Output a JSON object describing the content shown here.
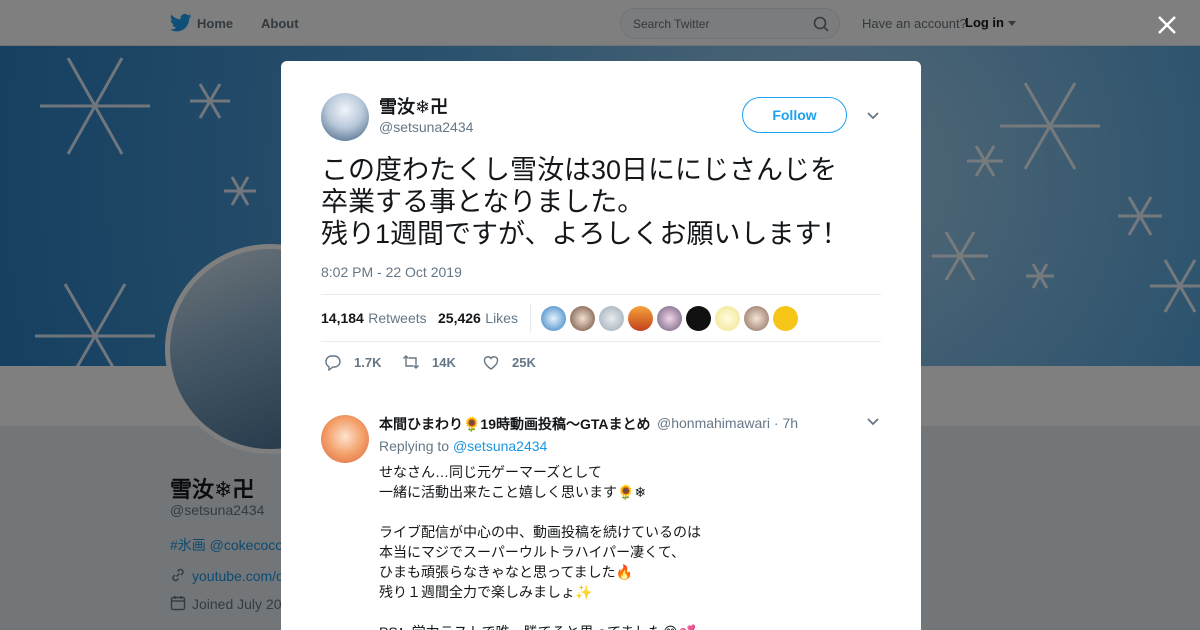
{
  "nav": {
    "home_label": "Home",
    "about_label": "About",
    "search_placeholder": "Search Twitter",
    "account_prompt": "Have an account?",
    "login_label": "Log in"
  },
  "profile": {
    "name": "雪汝❄卍",
    "handle": "@setsuna2434",
    "tags": "#氷画 @cokecoco",
    "link": "youtube.com/c",
    "joined": "Joined July 20"
  },
  "tweet": {
    "name": "雪汝❄卍",
    "handle": "@setsuna2434",
    "follow_label": "Follow",
    "text": "この度わたくし雪汝は30日ににじさんじを\n卒業する事となりました。\n残り1週間ですが、よろしくお願いします！",
    "timestamp": "8:02 PM - 22 Oct 2019",
    "retweets_count": "14,184",
    "retweets_label": "Retweets",
    "likes_count": "25,426",
    "likes_label": "Likes",
    "reply_count": "1.7K",
    "retweet_count_short": "14K",
    "like_count_short": "25K"
  },
  "reply": {
    "name": "本間ひまわり🌻19時動画投稿～GTAまとめ",
    "handle_time": "@honmahimawari · 7h",
    "replying_prefix": "Replying to",
    "replying_to": "@setsuna2434",
    "text": "せなさん…同じ元ゲーマーズとして\n一緒に活動出来たこと嬉しく思います🌻❄\n\nライブ配信が中心の中、動画投稿を続けているのは\n本当にマジでスーパーウルトラハイパー凄くて、\nひまも頑張らなきゃなと思ってました🔥\n残り１週間全力で楽しみましょ✨\n\nPS：学力テストで唯一勝てると思ってました😂💕"
  },
  "colors": {
    "accent": "#1da1f2",
    "text_secondary": "#657786",
    "banner": "#4a9bd6"
  }
}
